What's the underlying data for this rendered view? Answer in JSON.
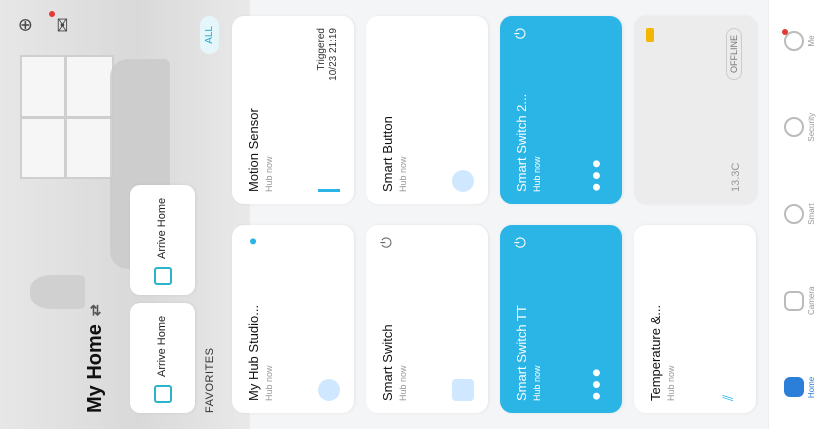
{
  "header": {
    "title": "My Home",
    "switch_icon": "swap-icon"
  },
  "top_icons": [
    {
      "name": "add-circle-icon"
    },
    {
      "name": "message-icon"
    }
  ],
  "scenes": [
    {
      "label": "Arrive Home"
    },
    {
      "label": "Arrive Home"
    }
  ],
  "favorites": {
    "label": "FAVORITES",
    "all_label": "ALL"
  },
  "devices": [
    {
      "name": "My Hub Studio...",
      "sub": "Hub now",
      "style": "white",
      "state": ""
    },
    {
      "name": "Motion Sensor",
      "sub": "Hub now",
      "style": "white",
      "state": "Triggered\n10/23 21:19"
    },
    {
      "name": "Smart Switch",
      "sub": "Hub now",
      "style": "white",
      "state": ""
    },
    {
      "name": "Smart Button",
      "sub": "Hub now",
      "style": "white",
      "state": ""
    },
    {
      "name": "Smart Switch TT",
      "sub": "Hub now",
      "style": "blue",
      "state": ""
    },
    {
      "name": "Smart Switch 2...",
      "sub": "Hub now",
      "style": "blue",
      "state": ""
    },
    {
      "name": "Temperature &...",
      "sub": "Hub now",
      "style": "white",
      "state": ""
    },
    {
      "name": "",
      "sub": "",
      "style": "grey",
      "state": "OFFLINE",
      "temp": "13.3C"
    }
  ],
  "nav": [
    {
      "label": "Home",
      "active": true
    },
    {
      "label": "Camera"
    },
    {
      "label": "Smart"
    },
    {
      "label": "Security"
    },
    {
      "label": "Me",
      "dot": true
    }
  ],
  "colors": {
    "accent": "#2bb4e6",
    "scene_icon": "#2bb3c9",
    "battery": "#f2b705",
    "alert": "#e53935"
  }
}
